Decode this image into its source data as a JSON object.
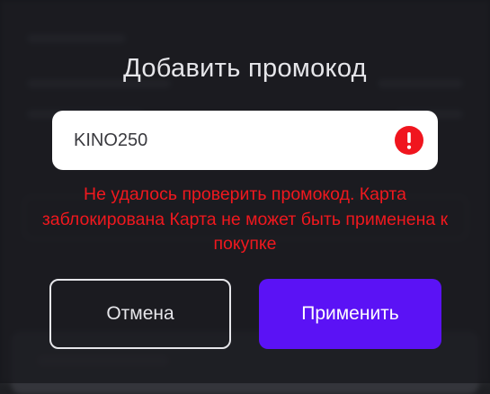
{
  "dialog": {
    "title": "Добавить промокод",
    "promo_input": {
      "value": "KINO250",
      "placeholder": ""
    },
    "error_icon": "exclamation-icon",
    "error_icon_glyph": "!",
    "error_message": "Не удалось проверить промокод. Карта заблокирована Карта не может быть применена к покупке",
    "cancel_label": "Отмена",
    "apply_label": "Применить"
  },
  "colors": {
    "accent": "#5b12f5",
    "error": "#f0151e",
    "text": "#e6e6ea",
    "field_bg": "#ffffff",
    "backdrop": "#1f2024"
  }
}
